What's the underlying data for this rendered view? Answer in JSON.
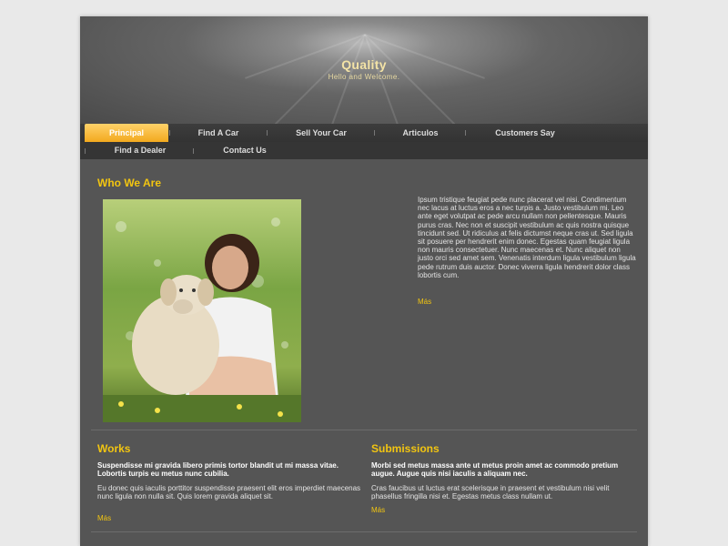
{
  "header": {
    "title": "Quality",
    "subtitle": "Hello and Welcome."
  },
  "nav": {
    "row1": [
      "Principal",
      "Find A Car",
      "Sell Your Car",
      "Articulos",
      "Customers Say"
    ],
    "row2": [
      "Find a Dealer",
      "Contact Us"
    ],
    "active": "Principal"
  },
  "who": {
    "title": "Who We Are",
    "image": "woman-with-dog-photo",
    "text": "Ipsum tristique feugiat pede nunc placerat vel nisi. Condimentum nec lacus at luctus eros a nec turpis a. Justo vestibulum mi. Leo ante eget volutpat ac pede arcu nullam non pellentesque. Mauris purus cras. Nec non et suscipit vestibulum ac quis nostra quisque tincidunt sed. Ut ridiculus at felis dictumst neque cras ut. Sed ligula sit posuere per hendrerit enim donec. Egestas quam feugiat ligula non mauris consectetuer. Nunc maecenas et. Nunc aliquet non justo orci sed amet sem. Venenatis interdum ligula vestibulum ligula pede rutrum duis auctor. Donec viverra ligula hendrerit dolor class lobortis cum.",
    "more": "Más"
  },
  "works": {
    "title": "Works",
    "lead": "Suspendisse mi gravida libero primis tortor blandit ut mi massa vitae. Lobortis turpis eu metus nunc cubilia.",
    "text": "Eu donec quis iaculis porttitor suspendisse praesent elit eros imperdiet maecenas nunc ligula non nulla sit. Quis lorem gravida aliquet sit.",
    "more": "Más"
  },
  "submissions": {
    "title": "Submissions",
    "lead": "Morbi sed metus massa ante ut metus proin amet ac commodo pretium augue. Augue quis nisi iaculis a aliquam nec.",
    "text": "Cras faucibus ut luctus erat scelerisque in praesent et vestibulum nisi velit phasellus fringilla nisi et. Egestas metus class nullam ut.",
    "more": "Más"
  },
  "colors": {
    "accent": "#f2c511",
    "page_bg": "#555555",
    "nav_active": "#f2a91e"
  }
}
